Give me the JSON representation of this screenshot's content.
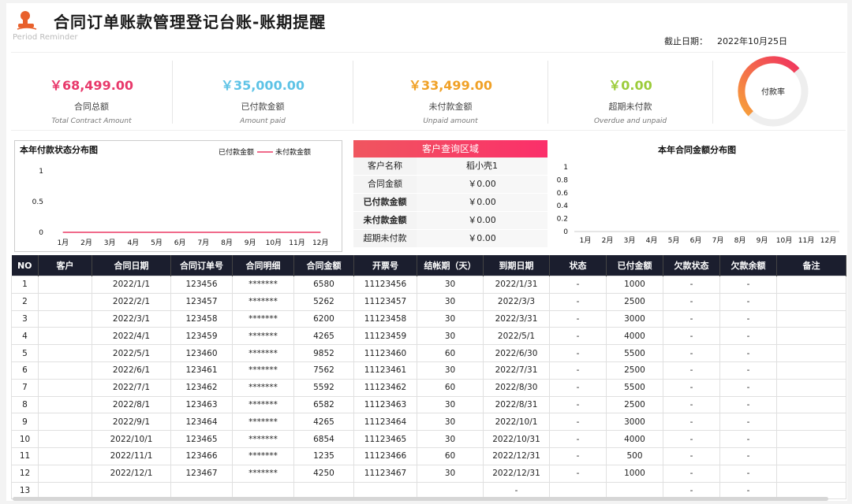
{
  "header": {
    "title": "合同订单账款管理登记台账-账期提醒",
    "subtitle": "Period Reminder",
    "deadline_label": "截止日期：",
    "deadline_value": "2022年10月25日"
  },
  "kpis": [
    {
      "amount": "￥68,499.00",
      "label": "合同总额",
      "en": "Total Contract Amount",
      "color": "#e8396b"
    },
    {
      "amount": "￥35,000.00",
      "label": "已付款金额",
      "en": "Amount paid",
      "color": "#5ec3e6"
    },
    {
      "amount": "￥33,499.00",
      "label": "未付款金额",
      "en": "Unpaid amount",
      "color": "#f0a127"
    },
    {
      "amount": "￥0.00",
      "label": "超期未付款",
      "en": "Overdue and unpaid",
      "color": "#9ccc3b"
    }
  ],
  "gauge": {
    "label": "付款率",
    "value": 0.51
  },
  "chart1": {
    "title": "本年付款状态分布图",
    "legend": [
      "已付款金额",
      "未付款金额"
    ],
    "yticks": [
      "1",
      "0.5",
      "0"
    ]
  },
  "query": {
    "title": "客户查询区域",
    "rows": [
      {
        "k": "客户名称",
        "v": "稻小壳1",
        "bold": false
      },
      {
        "k": "合同金额",
        "v": "￥0.00",
        "bold": false
      },
      {
        "k": "已付款金额",
        "v": "￥0.00",
        "bold": true
      },
      {
        "k": "未付款金额",
        "v": "￥0.00",
        "bold": true
      },
      {
        "k": "超期未付款",
        "v": "￥0.00",
        "bold": false
      }
    ]
  },
  "chart2": {
    "title": "本年合同金额分布图",
    "yticks": [
      "1",
      "0.8",
      "0.6",
      "0.4",
      "0.2",
      "0"
    ]
  },
  "chart_data": [
    {
      "type": "line",
      "title": "本年付款状态分布图",
      "categories": [
        "1月",
        "2月",
        "3月",
        "4月",
        "5月",
        "6月",
        "7月",
        "8月",
        "9月",
        "10月",
        "11月",
        "12月"
      ],
      "series": [
        {
          "name": "已付款金额",
          "values": [
            0,
            0,
            0,
            0,
            0,
            0,
            0,
            0,
            0,
            0,
            0,
            0
          ],
          "color": "#111111"
        },
        {
          "name": "未付款金额",
          "values": [
            0,
            0,
            0,
            0,
            0,
            0,
            0,
            0,
            0,
            0,
            0,
            0
          ],
          "color": "#f06a8a"
        }
      ],
      "ylim": [
        0,
        1
      ],
      "legend": "top-right"
    },
    {
      "type": "bar",
      "title": "本年合同金额分布图",
      "categories": [
        "1月",
        "2月",
        "3月",
        "4月",
        "5月",
        "6月",
        "7月",
        "8月",
        "9月",
        "10月",
        "11月",
        "12月"
      ],
      "values": [
        0,
        0,
        0,
        0,
        0,
        0,
        0,
        0,
        0,
        0,
        0,
        0
      ],
      "ylim": [
        0,
        1
      ]
    }
  ],
  "table": {
    "headers": [
      "NO",
      "客户",
      "合同日期",
      "合同订单号",
      "合同明细",
      "合同金额",
      "开票号",
      "结帐期（天）",
      "到期日期",
      "状态",
      "已付金额",
      "欠款状态",
      "欠款余额",
      "备注"
    ],
    "rows": [
      [
        "1",
        "",
        "2022/1/1",
        "123456",
        "*******",
        "6580",
        "11123456",
        "30",
        "2022/1/31",
        "-",
        "1000",
        "-",
        "-",
        ""
      ],
      [
        "2",
        "",
        "2022/2/1",
        "123457",
        "*******",
        "5262",
        "11123457",
        "30",
        "2022/3/3",
        "-",
        "2500",
        "-",
        "-",
        ""
      ],
      [
        "3",
        "",
        "2022/3/1",
        "123458",
        "*******",
        "6200",
        "11123458",
        "30",
        "2022/3/31",
        "-",
        "3000",
        "-",
        "-",
        ""
      ],
      [
        "4",
        "",
        "2022/4/1",
        "123459",
        "*******",
        "4265",
        "11123459",
        "30",
        "2022/5/1",
        "-",
        "4000",
        "-",
        "-",
        ""
      ],
      [
        "5",
        "",
        "2022/5/1",
        "123460",
        "*******",
        "9852",
        "11123460",
        "60",
        "2022/6/30",
        "-",
        "5500",
        "-",
        "-",
        ""
      ],
      [
        "6",
        "",
        "2022/6/1",
        "123461",
        "*******",
        "7562",
        "11123461",
        "30",
        "2022/7/31",
        "-",
        "2500",
        "-",
        "-",
        ""
      ],
      [
        "7",
        "",
        "2022/7/1",
        "123462",
        "*******",
        "5592",
        "11123462",
        "60",
        "2022/8/30",
        "-",
        "5500",
        "-",
        "-",
        ""
      ],
      [
        "8",
        "",
        "2022/8/1",
        "123463",
        "*******",
        "6582",
        "11123463",
        "30",
        "2022/8/31",
        "-",
        "2500",
        "-",
        "-",
        ""
      ],
      [
        "9",
        "",
        "2022/9/1",
        "123464",
        "*******",
        "4265",
        "11123464",
        "30",
        "2022/10/1",
        "-",
        "3000",
        "-",
        "-",
        ""
      ],
      [
        "10",
        "",
        "2022/10/1",
        "123465",
        "*******",
        "6854",
        "11123465",
        "30",
        "2022/10/31",
        "-",
        "4000",
        "-",
        "-",
        ""
      ],
      [
        "11",
        "",
        "2022/11/1",
        "123466",
        "*******",
        "1235",
        "11123466",
        "60",
        "2022/12/31",
        "-",
        "500",
        "-",
        "-",
        ""
      ],
      [
        "12",
        "",
        "2022/12/1",
        "123467",
        "*******",
        "4250",
        "11123467",
        "30",
        "2022/12/31",
        "-",
        "1000",
        "-",
        "-",
        ""
      ],
      [
        "13",
        "",
        "",
        "",
        "",
        "",
        "",
        "",
        "-",
        "",
        "",
        "-",
        "-",
        ""
      ]
    ]
  }
}
